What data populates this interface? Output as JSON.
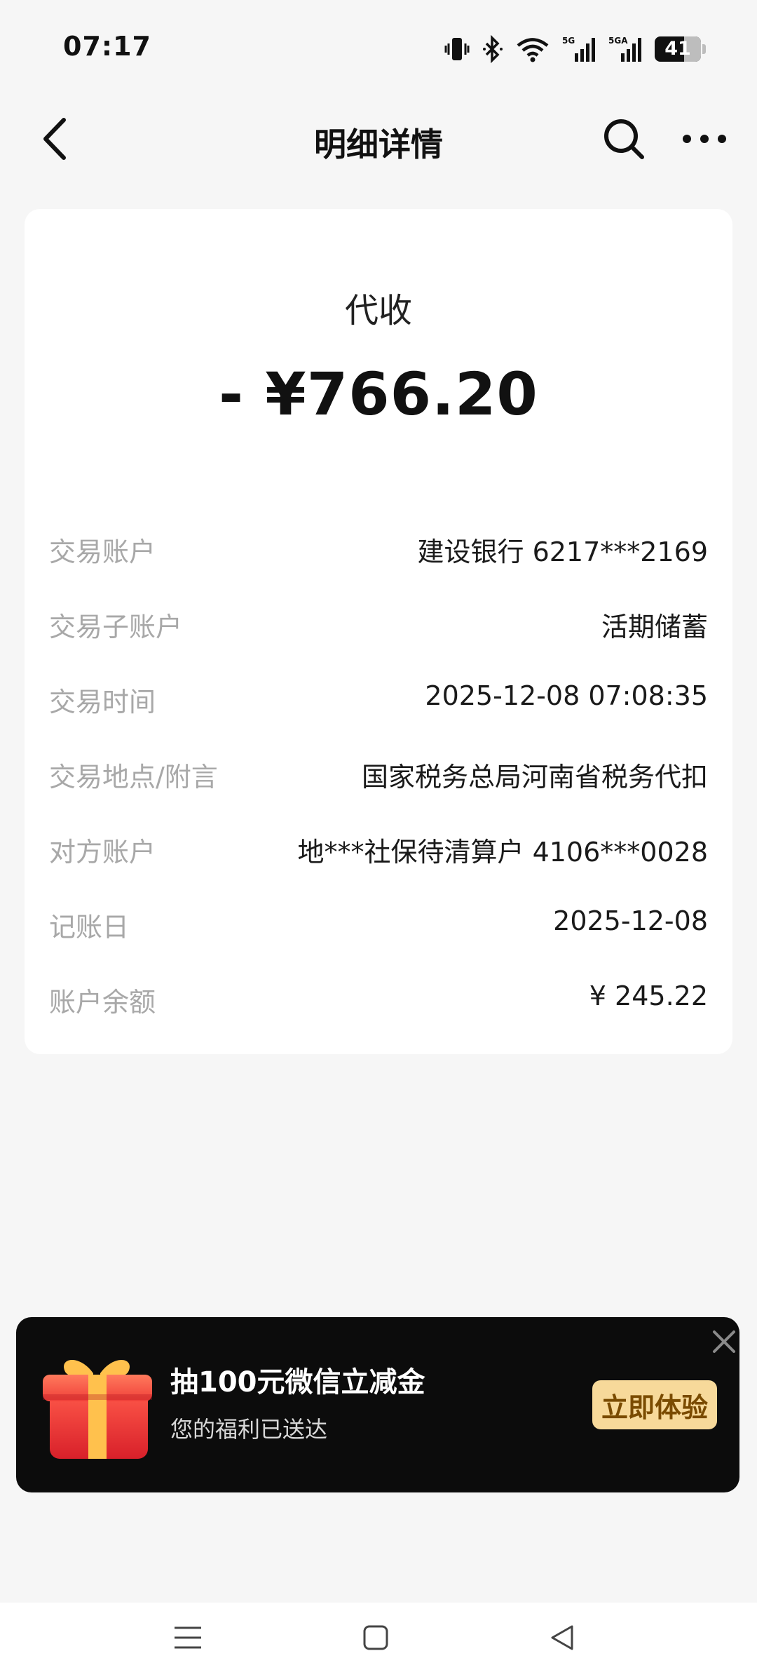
{
  "status_bar": {
    "time": "07:17",
    "battery_level": "41",
    "network_1": "5G",
    "network_2": "5G",
    "icons": [
      "vibrate-icon",
      "bluetooth-icon",
      "wifi-icon",
      "signal-5g-icon",
      "signal-5ga-icon",
      "battery-icon"
    ]
  },
  "nav": {
    "title": "明细详情",
    "back_icon": "chevron-left-icon",
    "search_icon": "search-icon",
    "more_icon": "more-icon"
  },
  "detail": {
    "type": "代收",
    "amount": "- ¥766.20",
    "rows": [
      {
        "label": "交易账户",
        "value": "建设银行 6217***2169"
      },
      {
        "label": "交易子账户",
        "value": "活期储蓄"
      },
      {
        "label": "交易时间",
        "value": "2025-12-08 07:08:35"
      },
      {
        "label": "交易地点/附言",
        "value": "国家税务总局河南省税务代扣"
      },
      {
        "label": "对方账户",
        "value": "地***社保待清算户 4106***0028"
      },
      {
        "label": "记账日",
        "value": "2025-12-08"
      },
      {
        "label": "账户余额",
        "value": "¥ 245.22"
      }
    ]
  },
  "promo": {
    "title": "抽100元微信立减金",
    "subtitle": "您的福利已送达",
    "cta": "立即体验",
    "colors": {
      "background": "#0c0c0c",
      "cta_bg": "#f7d99a",
      "cta_text": "#7a4b00"
    }
  },
  "system_nav": {
    "icons": [
      "menu-icon",
      "home-icon",
      "back-triangle-icon"
    ]
  }
}
